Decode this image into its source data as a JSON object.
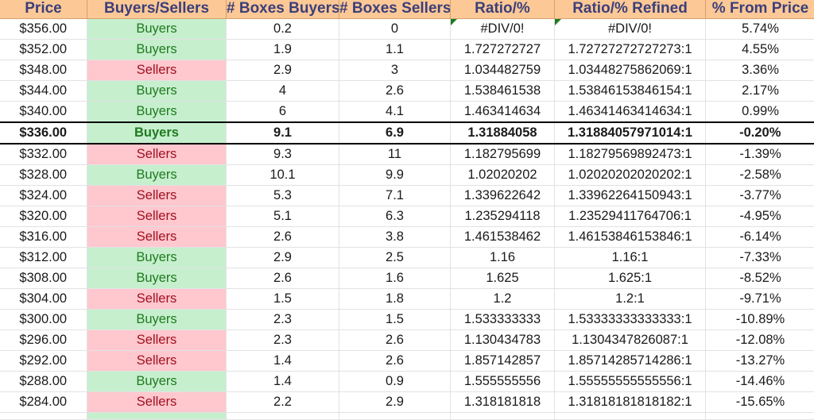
{
  "columns": [
    "Price",
    "Buyers/Sellers",
    "# Boxes Buyers",
    "# Boxes Sellers",
    "Ratio/%",
    "Ratio/% Refined",
    "% From Price"
  ],
  "rows": [
    {
      "price": "$356.00",
      "side": "Buyers",
      "boxes_buyers": "0.2",
      "boxes_sellers": "0",
      "ratio": "#DIV/0!",
      "refined": "#DIV/0!",
      "from_price": "5.74%",
      "error_flag": true
    },
    {
      "price": "$352.00",
      "side": "Buyers",
      "boxes_buyers": "1.9",
      "boxes_sellers": "1.1",
      "ratio": "1.727272727",
      "refined": "1.72727272727273:1",
      "from_price": "4.55%"
    },
    {
      "price": "$348.00",
      "side": "Sellers",
      "boxes_buyers": "2.9",
      "boxes_sellers": "3",
      "ratio": "1.034482759",
      "refined": "1.03448275862069:1",
      "from_price": "3.36%"
    },
    {
      "price": "$344.00",
      "side": "Buyers",
      "boxes_buyers": "4",
      "boxes_sellers": "2.6",
      "ratio": "1.538461538",
      "refined": "1.53846153846154:1",
      "from_price": "2.17%"
    },
    {
      "price": "$340.00",
      "side": "Buyers",
      "boxes_buyers": "6",
      "boxes_sellers": "4.1",
      "ratio": "1.463414634",
      "refined": "1.46341463414634:1",
      "from_price": "0.99%"
    },
    {
      "price": "$336.00",
      "side": "Buyers",
      "boxes_buyers": "9.1",
      "boxes_sellers": "6.9",
      "ratio": "1.31884058",
      "refined": "1.31884057971014:1",
      "from_price": "-0.20%",
      "current": true
    },
    {
      "price": "$332.00",
      "side": "Sellers",
      "boxes_buyers": "9.3",
      "boxes_sellers": "11",
      "ratio": "1.182795699",
      "refined": "1.18279569892473:1",
      "from_price": "-1.39%"
    },
    {
      "price": "$328.00",
      "side": "Buyers",
      "boxes_buyers": "10.1",
      "boxes_sellers": "9.9",
      "ratio": "1.02020202",
      "refined": "1.02020202020202:1",
      "from_price": "-2.58%"
    },
    {
      "price": "$324.00",
      "side": "Sellers",
      "boxes_buyers": "5.3",
      "boxes_sellers": "7.1",
      "ratio": "1.339622642",
      "refined": "1.33962264150943:1",
      "from_price": "-3.77%"
    },
    {
      "price": "$320.00",
      "side": "Sellers",
      "boxes_buyers": "5.1",
      "boxes_sellers": "6.3",
      "ratio": "1.235294118",
      "refined": "1.23529411764706:1",
      "from_price": "-4.95%"
    },
    {
      "price": "$316.00",
      "side": "Sellers",
      "boxes_buyers": "2.6",
      "boxes_sellers": "3.8",
      "ratio": "1.461538462",
      "refined": "1.46153846153846:1",
      "from_price": "-6.14%"
    },
    {
      "price": "$312.00",
      "side": "Buyers",
      "boxes_buyers": "2.9",
      "boxes_sellers": "2.5",
      "ratio": "1.16",
      "refined": "1.16:1",
      "from_price": "-7.33%"
    },
    {
      "price": "$308.00",
      "side": "Buyers",
      "boxes_buyers": "2.6",
      "boxes_sellers": "1.6",
      "ratio": "1.625",
      "refined": "1.625:1",
      "from_price": "-8.52%"
    },
    {
      "price": "$304.00",
      "side": "Sellers",
      "boxes_buyers": "1.5",
      "boxes_sellers": "1.8",
      "ratio": "1.2",
      "refined": "1.2:1",
      "from_price": "-9.71%"
    },
    {
      "price": "$300.00",
      "side": "Buyers",
      "boxes_buyers": "2.3",
      "boxes_sellers": "1.5",
      "ratio": "1.533333333",
      "refined": "1.53333333333333:1",
      "from_price": "-10.89%"
    },
    {
      "price": "$296.00",
      "side": "Sellers",
      "boxes_buyers": "2.3",
      "boxes_sellers": "2.6",
      "ratio": "1.130434783",
      "refined": "1.1304347826087:1",
      "from_price": "-12.08%"
    },
    {
      "price": "$292.00",
      "side": "Sellers",
      "boxes_buyers": "1.4",
      "boxes_sellers": "2.6",
      "ratio": "1.857142857",
      "refined": "1.85714285714286:1",
      "from_price": "-13.27%"
    },
    {
      "price": "$288.00",
      "side": "Buyers",
      "boxes_buyers": "1.4",
      "boxes_sellers": "0.9",
      "ratio": "1.555555556",
      "refined": "1.55555555555556:1",
      "from_price": "-14.46%"
    },
    {
      "price": "$284.00",
      "side": "Sellers",
      "boxes_buyers": "2.2",
      "boxes_sellers": "2.9",
      "ratio": "1.318181818",
      "refined": "1.31818181818182:1",
      "from_price": "-15.65%"
    }
  ],
  "partial_next_row_side": "Buyers",
  "colors": {
    "header_bg": "#fcc896",
    "header_text": "#3b3f7a",
    "buyers_bg": "#c6efce",
    "buyers_text": "#1e7a1e",
    "sellers_bg": "#ffc7ce",
    "sellers_text": "#a01020",
    "error_flag": "#1f7a1f"
  }
}
